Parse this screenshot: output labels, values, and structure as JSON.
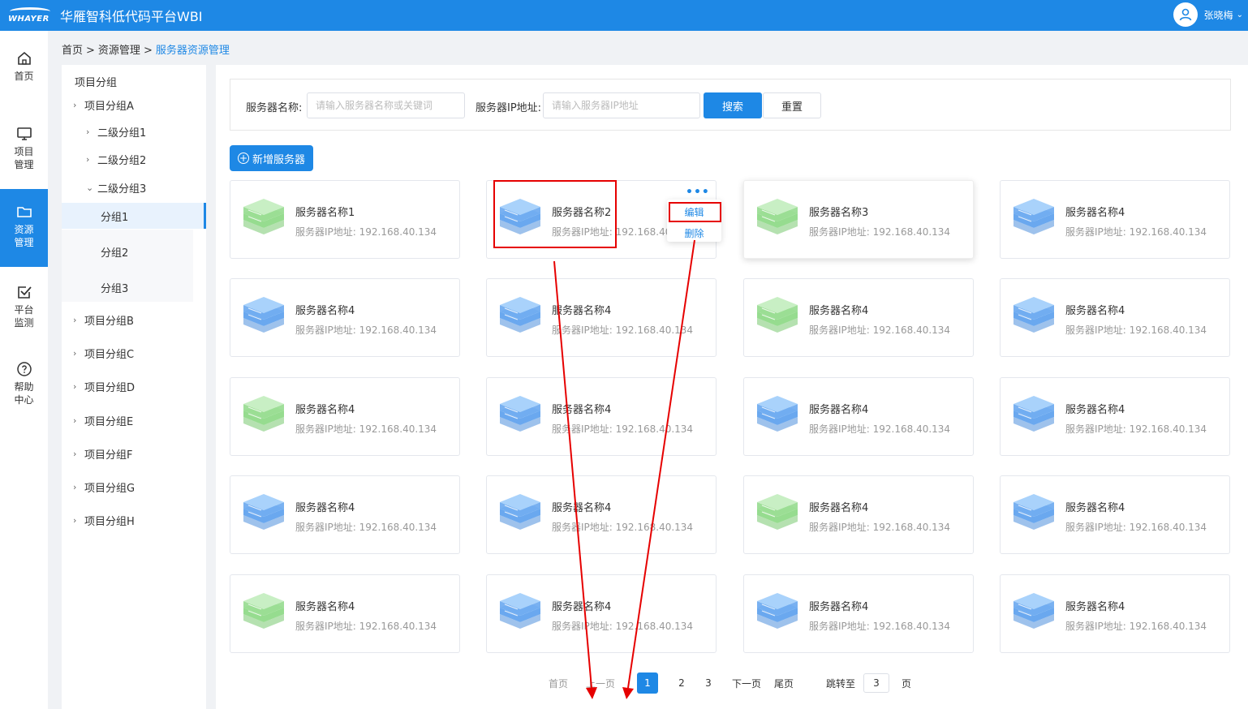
{
  "header": {
    "logo_text": "WHAYER",
    "app_title": "华雁智科低代码平台WBI",
    "user_name": "张晓梅"
  },
  "nav": [
    {
      "label_1": "首页",
      "label_2": "",
      "icon": "home-icon"
    },
    {
      "label_1": "项目",
      "label_2": "管理",
      "icon": "monitor-icon"
    },
    {
      "label_1": "资源",
      "label_2": "管理",
      "icon": "folder-icon",
      "active": true
    },
    {
      "label_1": "平台",
      "label_2": "监测",
      "icon": "check-square-icon"
    },
    {
      "label_1": "帮助",
      "label_2": "中心",
      "icon": "help-circle-icon"
    }
  ],
  "breadcrumb": {
    "home": "首页",
    "sep": ">",
    "level2": "资源管理",
    "current": "服务器资源管理"
  },
  "tree": {
    "title": "项目分组",
    "items": [
      {
        "label": "项目分组A",
        "arrow": "›"
      },
      {
        "label": "二级分组1",
        "arrow": "›"
      },
      {
        "label": "二级分组2",
        "arrow": "›"
      },
      {
        "label": "二级分组3",
        "arrow": "⌄"
      },
      {
        "label": "分组1",
        "arrow": ""
      },
      {
        "label": "分组2",
        "arrow": ""
      },
      {
        "label": "分组3",
        "arrow": ""
      },
      {
        "label": "项目分组B",
        "arrow": "›"
      },
      {
        "label": "项目分组C",
        "arrow": "›"
      },
      {
        "label": "项目分组D",
        "arrow": "›"
      },
      {
        "label": "项目分组E",
        "arrow": "›"
      },
      {
        "label": "项目分组F",
        "arrow": "›"
      },
      {
        "label": "项目分组G",
        "arrow": "›"
      },
      {
        "label": "项目分组H",
        "arrow": "›"
      }
    ]
  },
  "search": {
    "name_label": "服务器名称:",
    "name_placeholder": "请输入服务器名称或关键词",
    "ip_label": "服务器IP地址:",
    "ip_placeholder": "请输入服务器IP地址",
    "search_btn": "搜索",
    "reset_btn": "重置"
  },
  "add_button": "新增服务器",
  "card_menu": {
    "dots": "•••",
    "edit": "编辑",
    "delete": "删除"
  },
  "server_cards": [
    {
      "name": "服务器名称1",
      "ip": "服务器IP地址:  192.168.40.134",
      "color": "green"
    },
    {
      "name": "服务器名称2",
      "ip": "服务器IP地址:  192.168.40.134",
      "color": "blue"
    },
    {
      "name": "服务器名称3",
      "ip": "服务器IP地址:  192.168.40.134",
      "color": "green"
    },
    {
      "name": "服务器名称4",
      "ip": "服务器IP地址:  192.168.40.134",
      "color": "blue"
    },
    {
      "name": "服务器名称4",
      "ip": "服务器IP地址:  192.168.40.134",
      "color": "blue"
    },
    {
      "name": "服务器名称4",
      "ip": "服务器IP地址:  192.168.40.134",
      "color": "blue"
    },
    {
      "name": "服务器名称4",
      "ip": "服务器IP地址:  192.168.40.134",
      "color": "green"
    },
    {
      "name": "服务器名称4",
      "ip": "服务器IP地址:  192.168.40.134",
      "color": "blue"
    },
    {
      "name": "服务器名称4",
      "ip": "服务器IP地址:  192.168.40.134",
      "color": "green"
    },
    {
      "name": "服务器名称4",
      "ip": "服务器IP地址:  192.168.40.134",
      "color": "blue"
    },
    {
      "name": "服务器名称4",
      "ip": "服务器IP地址:  192.168.40.134",
      "color": "blue"
    },
    {
      "name": "服务器名称4",
      "ip": "服务器IP地址:  192.168.40.134",
      "color": "blue"
    },
    {
      "name": "服务器名称4",
      "ip": "服务器IP地址:  192.168.40.134",
      "color": "blue"
    },
    {
      "name": "服务器名称4",
      "ip": "服务器IP地址:  192.168.40.134",
      "color": "blue"
    },
    {
      "name": "服务器名称4",
      "ip": "服务器IP地址:  192.168.40.134",
      "color": "green"
    },
    {
      "name": "服务器名称4",
      "ip": "服务器IP地址:  192.168.40.134",
      "color": "blue"
    },
    {
      "name": "服务器名称4",
      "ip": "服务器IP地址:  192.168.40.134",
      "color": "green"
    },
    {
      "name": "服务器名称4",
      "ip": "服务器IP地址:  192.168.40.134",
      "color": "blue"
    },
    {
      "name": "服务器名称4",
      "ip": "服务器IP地址:  192.168.40.134",
      "color": "blue"
    },
    {
      "name": "服务器名称4",
      "ip": "服务器IP地址:  192.168.40.134",
      "color": "blue"
    }
  ],
  "pagination": {
    "first": "首页",
    "prev": "上一页",
    "pages": [
      "1",
      "2",
      "3"
    ],
    "current": "1",
    "next": "下一页",
    "last": "尾页",
    "jump_label": "跳转至",
    "jump_value": "3",
    "page_suffix": "页"
  },
  "colors": {
    "primary": "#1e88e5",
    "annotation": "#e60000",
    "server_blue": "#7bb6f5",
    "server_green": "#a8e0a8"
  }
}
